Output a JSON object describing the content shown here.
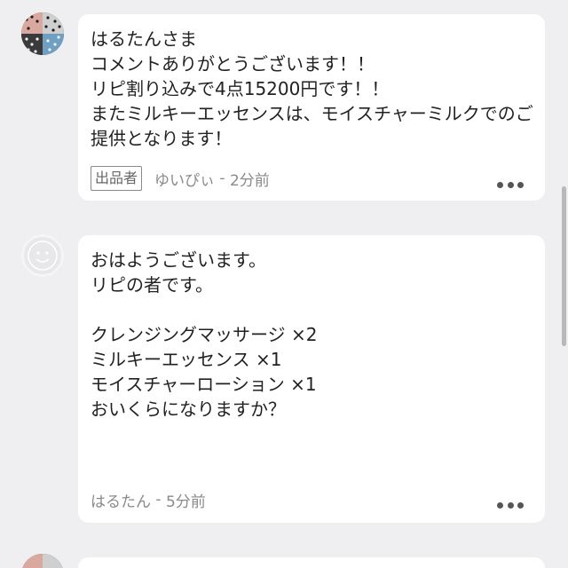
{
  "comments": [
    {
      "body": "はるたんさま\nコメントありがとうございます！！\nリピ割り込みで4点15200円です！！\nまたミルキーエッセンスは、モイスチャーミルクでのご提供となります！",
      "badge": "出品者",
      "author": "ゆいぴぃ",
      "separator": " - ",
      "time": "2分前"
    },
    {
      "body": "おはようございます。\nリピの者です。\n\nクレンジングマッサージ ×2\nミルキーエッセンス  ×1\nモイスチャーローション  ×1\nおいくらになりますか？",
      "author": "はるたん",
      "separator": " - ",
      "time": "5分前"
    }
  ]
}
